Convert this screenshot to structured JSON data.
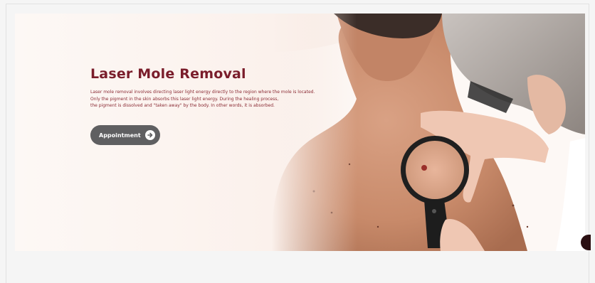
{
  "hero": {
    "title": "Laser Mole Removal",
    "description_lines": [
      "Laser mole removal involves directing laser light energy directly to the region where the mole is located.",
      "Only the pigment in the skin absorbs this laser light energy. During the healing process,",
      "the pigment is dissolved and \"taken away\" by the body. In other words, it is absorbed."
    ],
    "cta_label": "Appointment",
    "cta_icon": "arrow-right-circle-icon",
    "image": "doctor-examining-mole-with-magnifying-glass"
  },
  "colors": {
    "title": "#7a1d2b",
    "button_bg": "#5f5f61",
    "page_bg": "#f5f5f5"
  }
}
